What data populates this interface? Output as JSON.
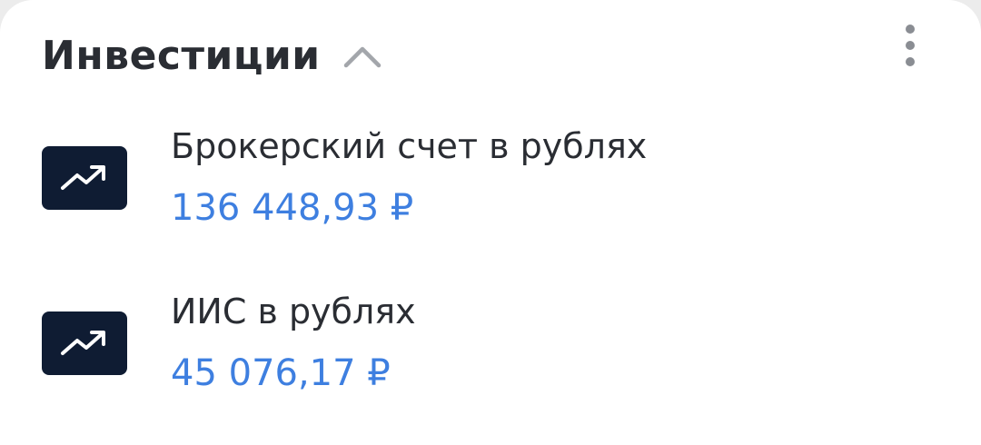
{
  "header": {
    "title": "Инвестиции",
    "collapse_icon": "chevron-up-icon",
    "menu_icon": "more-vertical-icon"
  },
  "accounts": [
    {
      "name": "Брокерский счет в рублях",
      "balance": "136 448,93 ₽",
      "icon": "trending-up-icon"
    },
    {
      "name": "ИИС в рублях",
      "balance": "45 076,17 ₽",
      "icon": "trending-up-icon"
    }
  ],
  "colors": {
    "title": "#2a2d33",
    "balance": "#3e7fe0",
    "icon_bg": "#0f1c33"
  }
}
